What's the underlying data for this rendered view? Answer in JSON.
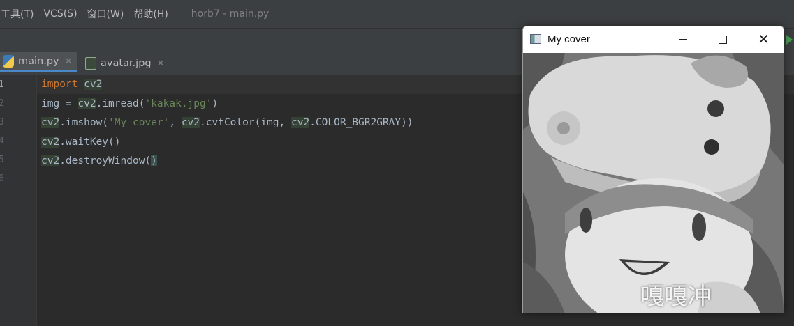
{
  "menubar": {
    "items": [
      "工具(T)",
      "VCS(S)",
      "窗口(W)",
      "帮助(H)"
    ],
    "window_title": "horb7 - main.py"
  },
  "tabs": [
    {
      "label": "main.py",
      "icon": "python-file-icon",
      "active": true
    },
    {
      "label": "avatar.jpg",
      "icon": "image-file-icon",
      "active": false
    }
  ],
  "gutter": {
    "line_numbers": [
      "1",
      "2",
      "3",
      "4",
      "5",
      "6"
    ]
  },
  "code": {
    "line1": {
      "kw": "import",
      "sp": " ",
      "mod": "cv2"
    },
    "line2": {
      "a": "img = ",
      "mod": "cv2",
      "b": ".imread(",
      "str": "'kakak.jpg'",
      "c": ")"
    },
    "line3": {
      "mod1": "cv2",
      "a": ".imshow(",
      "str": "'My cover'",
      "b": ", ",
      "mod2": "cv2",
      "c": ".cvtColor(img, ",
      "mod3": "cv2",
      "d": ".COLOR_BGR2GRAY))"
    },
    "line4": {
      "mod": "cv2",
      "a": ".waitKey()"
    },
    "line5": {
      "mod": "cv2",
      "a": ".destroyWindow(",
      "b": ")"
    }
  },
  "cv_window": {
    "title": "My cover",
    "caption": "嘎嘎冲",
    "minimize_label": "",
    "maximize_label": "",
    "close_label": "✕"
  },
  "colors": {
    "keyword": "#cc7832",
    "string": "#6a8759",
    "text": "#a9b7c6",
    "background": "#2b2b2b"
  }
}
